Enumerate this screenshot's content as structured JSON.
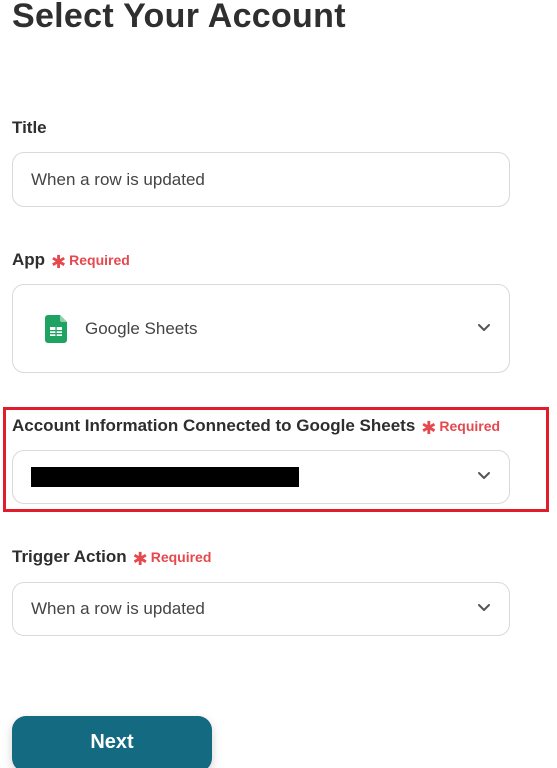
{
  "page": {
    "title": "Select Your Account"
  },
  "title_field": {
    "label": "Title",
    "value": "When a row is updated"
  },
  "app_field": {
    "label": "App",
    "required_text": "Required",
    "value": "Google Sheets",
    "icon": "google-sheets-icon"
  },
  "account_field": {
    "label": "Account Information Connected to Google Sheets",
    "required_text": "Required",
    "value": ""
  },
  "trigger_field": {
    "label": "Trigger Action",
    "required_text": "Required",
    "value": "When a row is updated"
  },
  "actions": {
    "next_label": "Next"
  },
  "colors": {
    "accent": "#146a80",
    "required": "#e5484d",
    "highlight": "#e01e2b",
    "google_sheets": "#1ea362"
  }
}
